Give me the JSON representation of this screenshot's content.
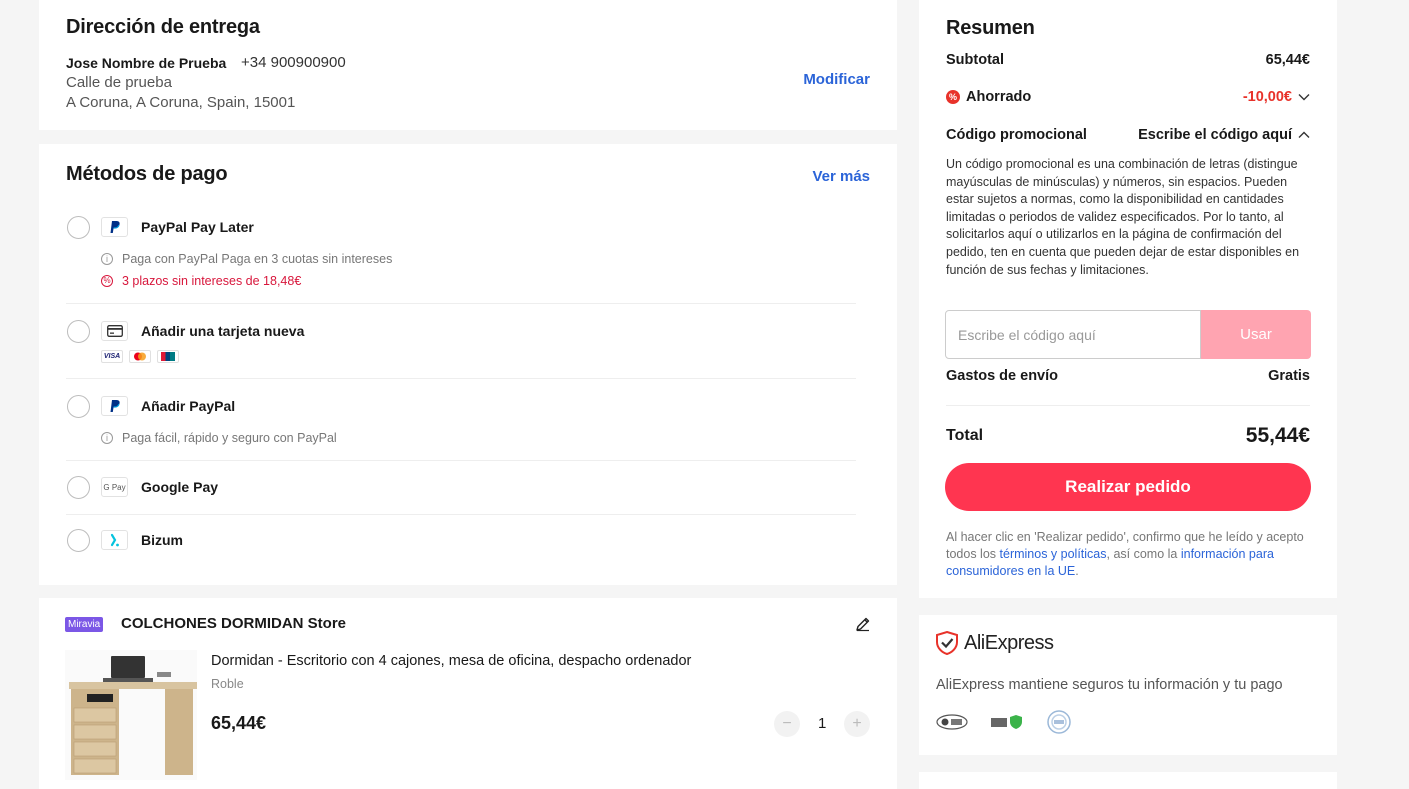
{
  "address": {
    "title": "Dirección de entrega",
    "name": "Jose Nombre de Prueba",
    "phone": "+34 900900900",
    "street": "Calle de prueba",
    "city": "A Coruna, A Coruna, Spain, 15001",
    "edit_label": "Modificar"
  },
  "payment": {
    "title": "Métodos de pago",
    "more_label": "Ver más",
    "methods": [
      {
        "label": "PayPal Pay Later",
        "sub": "Paga con PayPal Paga en 3 cuotas sin intereses",
        "promo": "3 plazos sin intereses de 18,48€"
      },
      {
        "label": "Añadir una tarjeta nueva",
        "cards": [
          "VISA",
          "MC",
          "UP"
        ]
      },
      {
        "label": "Añadir PayPal",
        "sub": "Paga fácil, rápido y seguro con PayPal"
      },
      {
        "label": "Google Pay",
        "logo": "G Pay"
      },
      {
        "label": "Bizum"
      }
    ]
  },
  "store": {
    "badge": "Miravia",
    "name": "COLCHONES DORMIDAN Store",
    "product": {
      "name": "Dormidan - Escritorio con 4 cajones, mesa de oficina, despacho ordenador",
      "variant": "Roble",
      "price": "65,44€",
      "qty": "1"
    }
  },
  "summary": {
    "title": "Resumen",
    "subtotal_label": "Subtotal",
    "subtotal": "65,44€",
    "saved_label": "Ahorrado",
    "saved": "-10,00€",
    "promo_label": "Código promocional",
    "promo_hint": "Escribe el código aquí",
    "promo_desc": "Un código promocional es una combinación de letras (distingue mayúsculas de minúsculas) y números, sin espacios. Pueden estar sujetos a normas, como la disponibilidad en cantidades limitadas o periodos de validez especificados. Por lo tanto, al solicitarlos aquí o utilizarlos en la página de confirmación del pedido, ten en cuenta que pueden dejar de estar disponibles en función de sus fechas y limitaciones.",
    "promo_placeholder": "Escribe el código aquí",
    "promo_button": "Usar",
    "shipping_label": "Gastos de envío",
    "shipping": "Gratis",
    "total_label": "Total",
    "total": "55,44€",
    "order_button": "Realizar pedido",
    "legal_1": "Al hacer clic en 'Realizar pedido', confirmo que he leído y acepto todos los ",
    "legal_link1": "términos y políticas",
    "legal_2": ", así como la ",
    "legal_link2": "información para consumidores en la UE",
    "legal_3": "."
  },
  "trust": {
    "brand": "AliExpress",
    "desc": "AliExpress mantiene seguros tu información y tu pago"
  },
  "colors": {
    "accent": "#ff3550",
    "link": "#2b64d8",
    "discount": "#e8322a"
  }
}
